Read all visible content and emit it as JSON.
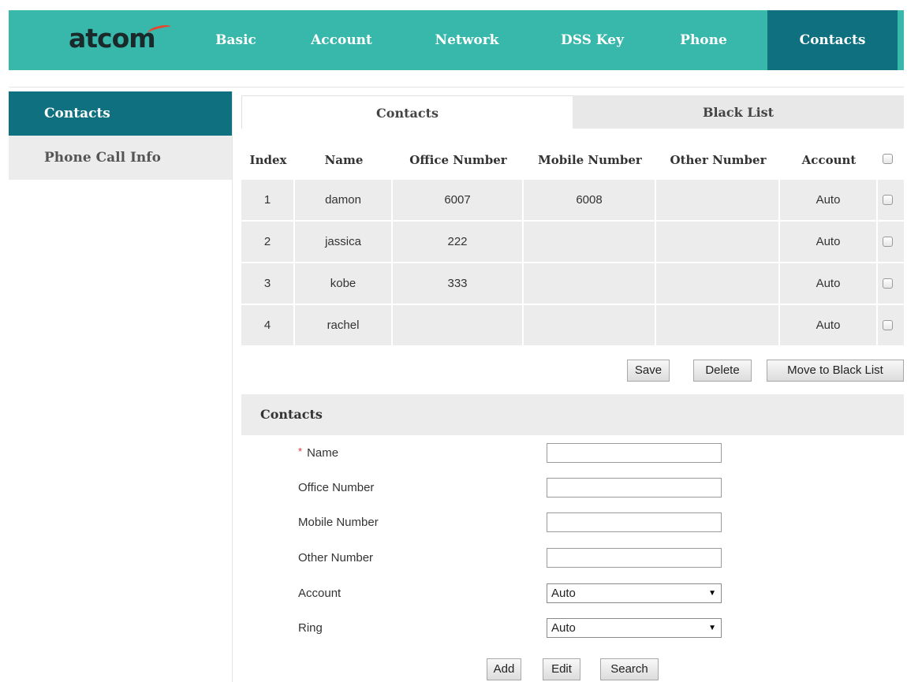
{
  "brand": {
    "logo_text": "atcom"
  },
  "nav": [
    {
      "label": "Basic",
      "active": false
    },
    {
      "label": "Account",
      "active": false
    },
    {
      "label": "Network",
      "active": false
    },
    {
      "label": "DSS Key",
      "active": false
    },
    {
      "label": "Phone",
      "active": false
    },
    {
      "label": "Contacts",
      "active": true
    }
  ],
  "sidebar": [
    {
      "label": "Contacts",
      "active": true
    },
    {
      "label": "Phone Call Info",
      "active": false
    }
  ],
  "tabs": [
    {
      "label": "Contacts",
      "active": true
    },
    {
      "label": "Black List",
      "active": false
    }
  ],
  "table": {
    "headers": [
      "Index",
      "Name",
      "Office Number",
      "Mobile Number",
      "Other Number",
      "Account"
    ],
    "rows": [
      {
        "index": "1",
        "name": "damon",
        "office": "6007",
        "mobile": "6008",
        "other": "",
        "account": "Auto",
        "checked": false
      },
      {
        "index": "2",
        "name": "jassica",
        "office": "222",
        "mobile": "",
        "other": "",
        "account": "Auto",
        "checked": false
      },
      {
        "index": "3",
        "name": "kobe",
        "office": "333",
        "mobile": "",
        "other": "",
        "account": "Auto",
        "checked": false
      },
      {
        "index": "4",
        "name": "rachel",
        "office": "",
        "mobile": "",
        "other": "",
        "account": "Auto",
        "checked": false
      }
    ]
  },
  "table_actions": {
    "save": "Save",
    "delete": "Delete",
    "move_to_black_list": "Move to Black List"
  },
  "form": {
    "title": "Contacts",
    "required_mark": "*",
    "name_label": "Name",
    "name_value": "",
    "office_label": "Office Number",
    "office_value": "",
    "mobile_label": "Mobile Number",
    "mobile_value": "",
    "other_label": "Other Number",
    "other_value": "",
    "account_label": "Account",
    "account_value": "Auto",
    "ring_label": "Ring",
    "ring_value": "Auto",
    "add": "Add",
    "edit": "Edit",
    "search": "Search"
  },
  "colors": {
    "nav_bg": "#38b7ab",
    "active_bg": "#0f7080",
    "row_bg": "#ececec",
    "required": "#e3342f"
  }
}
